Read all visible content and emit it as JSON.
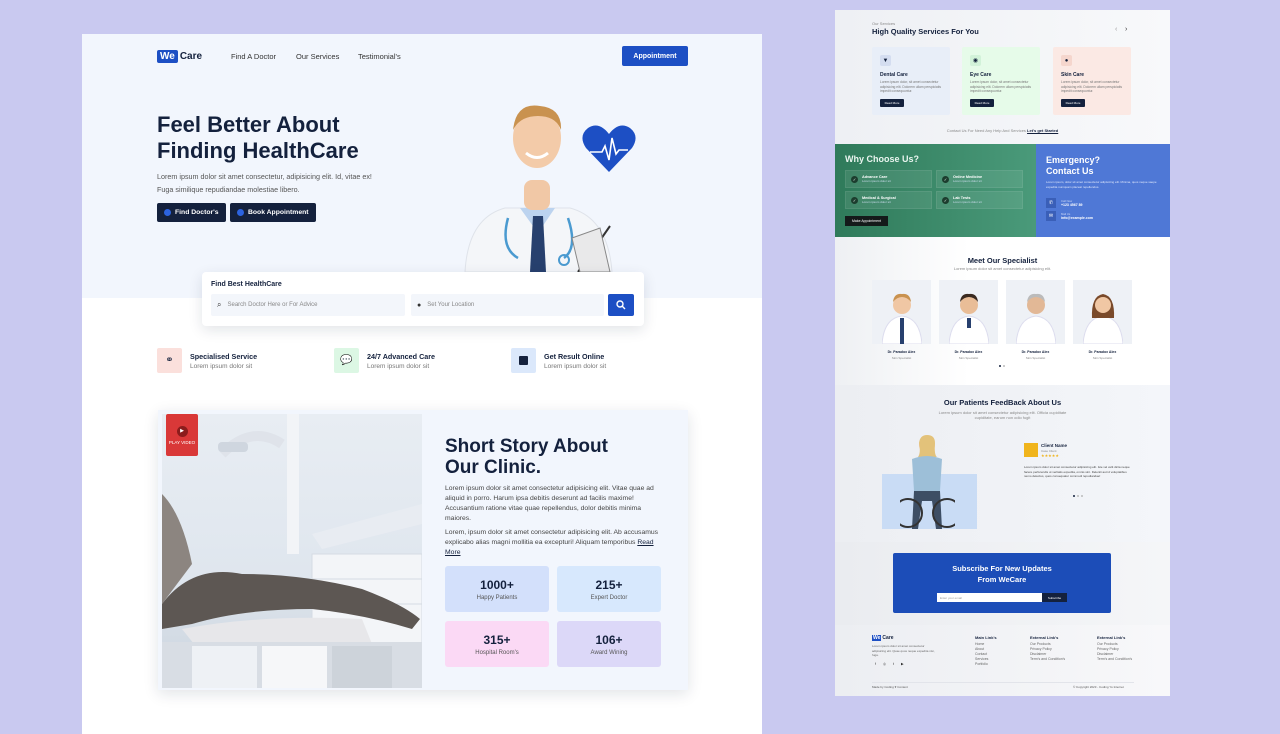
{
  "left": {
    "logo": {
      "we": "We",
      "care": "Care"
    },
    "nav": [
      "Find A Doctor",
      "Our Services",
      "Testimonial's"
    ],
    "appointment_button": "Appointment",
    "hero": {
      "title_line1": "Feel Better About",
      "title_line2": "Finding HealthCare",
      "lead": "Lorem ipsum dolor sit amet consectetur, adipisicing elit. Id, vitae ex! Fuga similique repudiandae molestiae libero.",
      "find_doctors": "Find Doctor's",
      "book_appointment": "Book Appointment"
    },
    "search": {
      "title": "Find Best HealthCare",
      "doctor_placeholder": "Search Doctor Here or For Advice",
      "location_placeholder": "Set Your Location"
    },
    "features": [
      {
        "title": "Specialised Service",
        "sub": "Lorem ipsum dolor sit",
        "icon": "binoculars-icon",
        "color": "#fbe0dc"
      },
      {
        "title": "24/7 Advanced Care",
        "sub": "Lorem ipsum dolor sit",
        "icon": "chat-icon",
        "color": "#dcf7e4"
      },
      {
        "title": "Get Result Online",
        "sub": "Lorem ipsum dolor sit",
        "icon": "document-icon",
        "color": "#dbe8fb"
      }
    ],
    "story": {
      "play_video": "PLAY VIDEO",
      "title_line1": "Short Story About",
      "title_line2": "Our Clinic.",
      "para1": "Lorem ipsum dolor sit amet consectetur adipisicing elit. Vitae quae ad aliquid in porro. Harum ipsa debitis deserunt ad facilis maxime! Accusantium ratione vitae quae repellendus, dolor debitis minima maiores.",
      "para2": "Lorem, ipsum dolor sit amet consectetur adipisicing elit. Ab accusamus explicabo alias magni mollitia ea excepturi! Aliquam temporibus",
      "read_more": "Read More",
      "stats": [
        {
          "value": "1000+",
          "label": "Happy Patients",
          "color": "#d3e0fb"
        },
        {
          "value": "215+",
          "label": "Expert Doctor",
          "color": "#d7e8fd"
        },
        {
          "value": "315+",
          "label": "Hospital Room's",
          "color": "#fbd9f5"
        },
        {
          "value": "106+",
          "label": "Award Wining",
          "color": "#dcd8f8"
        }
      ]
    }
  },
  "right": {
    "services": {
      "eyebrow": "Our Services",
      "title": "High Quality Services For You",
      "cards": [
        {
          "title": "Dental Care",
          "desc": "Lorem ipsum dolor, sit amet consectetur adipisicing elit. Dolorem ullam perspiciatis impedit consequuntur.",
          "button": "Read More",
          "color": "#e8eef8"
        },
        {
          "title": "Eye Care",
          "desc": "Lorem ipsum dolor, sit amet consectetur adipisicing elit. Dolorem ullam perspiciatis impedit consequuntur.",
          "button": "Read More",
          "color": "#e6fbe9"
        },
        {
          "title": "Skin Care",
          "desc": "Lorem ipsum dolor, sit amet consectetur adipisicing elit. Dolorem ullam perspiciatis impedit consequuntur.",
          "button": "Read More",
          "color": "#fbe9e4"
        }
      ],
      "footer_text": "Contact Us For Need Any Help And Services",
      "footer_link": "Let's get Started"
    },
    "why": {
      "title": "Why Choose Us?",
      "items": [
        {
          "title": "Advance Care",
          "sub": "Lorem ipsum dolor sit"
        },
        {
          "title": "Online Medicine",
          "sub": "Lorem ipsum dolor sit"
        },
        {
          "title": "Medical & Surgical",
          "sub": "Lorem ipsum dolor sit"
        },
        {
          "title": "Lab Tests",
          "sub": "Lorem ipsum dolor sit"
        }
      ],
      "button": "Make Appointment"
    },
    "emergency": {
      "title_line1": "Emergency?",
      "title_line2": "Contact Us",
      "desc": "Lorem ipsum, dolor sit amet consectetur adipisicing elit. Minima, quos neque saepe expedita numquam placeat repellendus.",
      "call_label": "Call Now",
      "phone": "+123 4567 89",
      "mail_label": "Mail Us",
      "email": "info@example.com"
    },
    "specialists": {
      "title": "Meet Our Specialist",
      "sub": "Lorem ipsum dolor sit amet consectetur adipisicing elit.",
      "people": [
        {
          "name": "Dr. Paradox Alex",
          "role": "Skin Specialist"
        },
        {
          "name": "Dr. Paradox Alex",
          "role": "Skin Specialist"
        },
        {
          "name": "Dr. Paradox Alex",
          "role": "Skin Specialist"
        },
        {
          "name": "Dr. Paradox Alex",
          "role": "Skin Specialist"
        }
      ]
    },
    "feedback": {
      "title": "Our Patients FeedBack About Us",
      "sub": "Lorem ipsum dolor sit amet consectetur adipisicing elit. Officia cupiditate cupiditate, earum non odio fugit",
      "client_name": "Client Name",
      "client_role": "Case Client",
      "rating": 5,
      "quote": "Lorem ipsum dolor sit amet consectetur adipisicing elit. Iste vel velit dicta neque facere perferendis ut veritatis expedita, omnis sint. Deleniti aut id voluptatibus nemo delectus, quos consequatur commodi repudiandae!"
    },
    "subscribe": {
      "title_line1": "Subscribe For New Updates",
      "title_line2": "From WeCare",
      "placeholder": "Enter your email",
      "button": "Subscribe"
    },
    "footer": {
      "logo_we": "We",
      "logo_care": "Care",
      "about": "Lorem ipsum dolor sit amet consectetur adipisicing elit. Quae quos neque expedita nisi, fuga.",
      "col1": {
        "title": "Main Link's",
        "links": [
          "Home",
          "About",
          "Contact",
          "Services",
          "Portfolio"
        ]
      },
      "col2": {
        "title": "External Link's",
        "links": [
          "Our Products",
          "Privacy Policy",
          "Disclaimer",
          "Term's and Condition's"
        ]
      },
      "col3": {
        "title": "External Link's",
        "links": [
          "Our Products",
          "Privacy Policy",
          "Disclaimer",
          "Term's and Condition's"
        ]
      },
      "made_by": "Made by Coding ♥ Content",
      "copyright": "© Copyright 2023 - Coding Yo Internet"
    }
  }
}
